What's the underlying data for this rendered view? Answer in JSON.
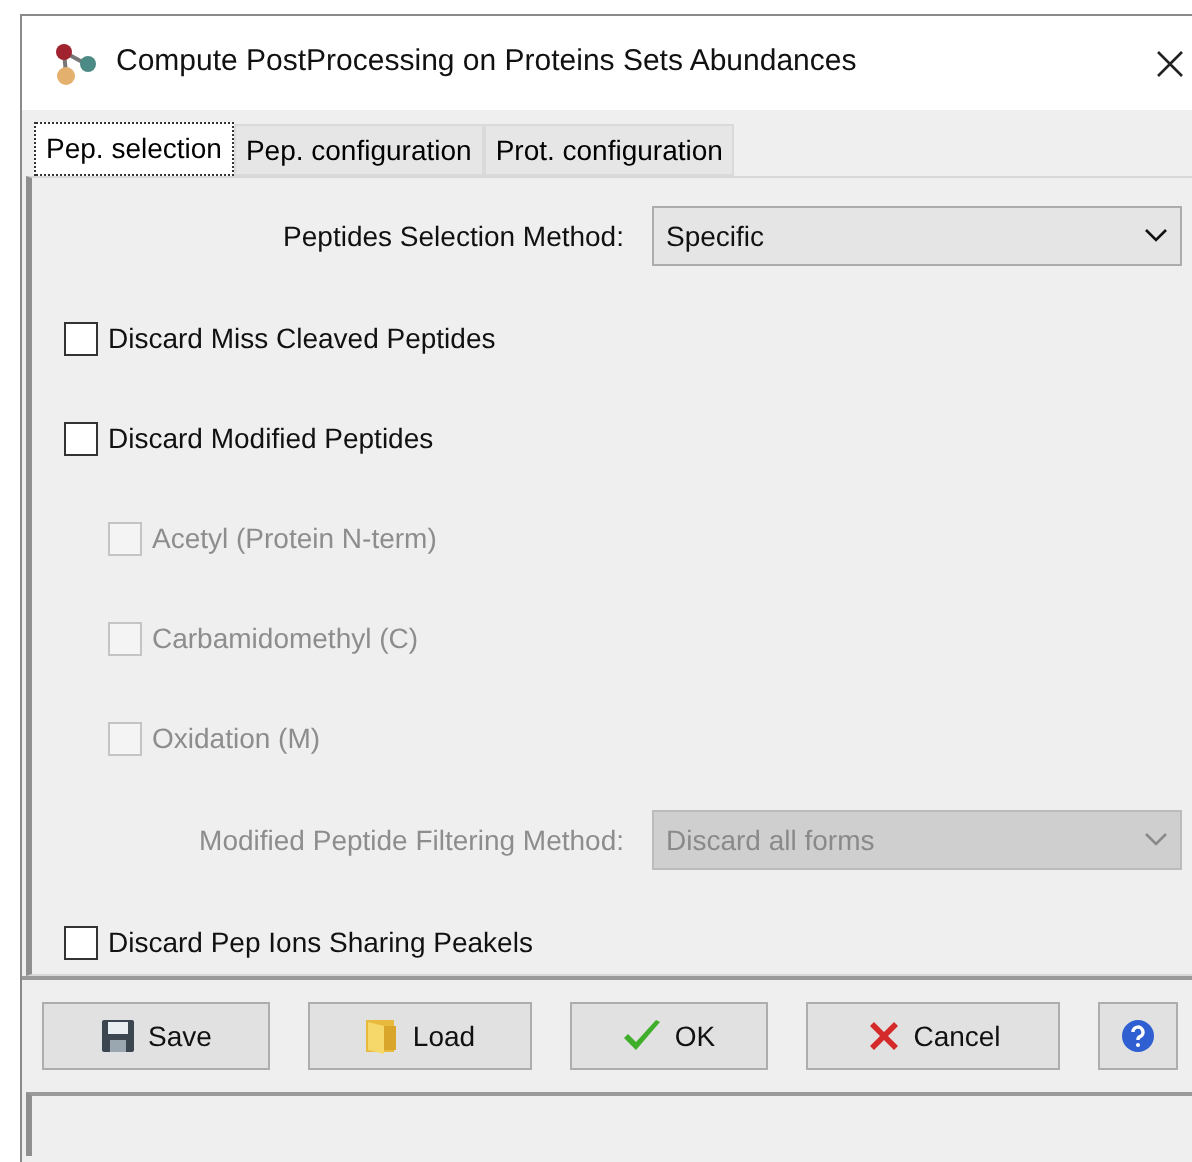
{
  "window": {
    "title": "Compute PostProcessing on Proteins Sets Abundances"
  },
  "tabs": [
    {
      "label": "Pep. selection",
      "selected": true
    },
    {
      "label": "Pep. configuration",
      "selected": false
    },
    {
      "label": "Prot. configuration",
      "selected": false
    }
  ],
  "items": [
    {
      "kind": "select",
      "label": "Peptides Selection Method:",
      "value": "Specific",
      "disabled": false
    },
    {
      "kind": "checkbox",
      "label": "Discard Miss Cleaved Peptides",
      "checked": false,
      "disabled": false
    },
    {
      "kind": "checkbox",
      "label": "Discard Modified Peptides",
      "checked": false,
      "disabled": false,
      "children": [
        {
          "kind": "checkbox",
          "label": "Acetyl (Protein N-term)",
          "checked": false,
          "disabled": true
        },
        {
          "kind": "checkbox",
          "label": "Carbamidomethyl (C)",
          "checked": false,
          "disabled": true
        },
        {
          "kind": "checkbox",
          "label": "Oxidation (M)",
          "checked": false,
          "disabled": true
        }
      ]
    },
    {
      "kind": "select",
      "label": "Modified Peptide Filtering Method:",
      "value": "Discard all forms",
      "disabled": true
    },
    {
      "kind": "checkbox",
      "label": "Discard Pep Ions Sharing Peakels",
      "checked": false,
      "disabled": false
    }
  ],
  "buttons": [
    {
      "kind": "save",
      "label": "Save"
    },
    {
      "kind": "load",
      "label": "Load"
    },
    {
      "kind": "ok",
      "label": "OK"
    },
    {
      "kind": "cancel",
      "label": "Cancel"
    },
    {
      "kind": "help"
    }
  ]
}
